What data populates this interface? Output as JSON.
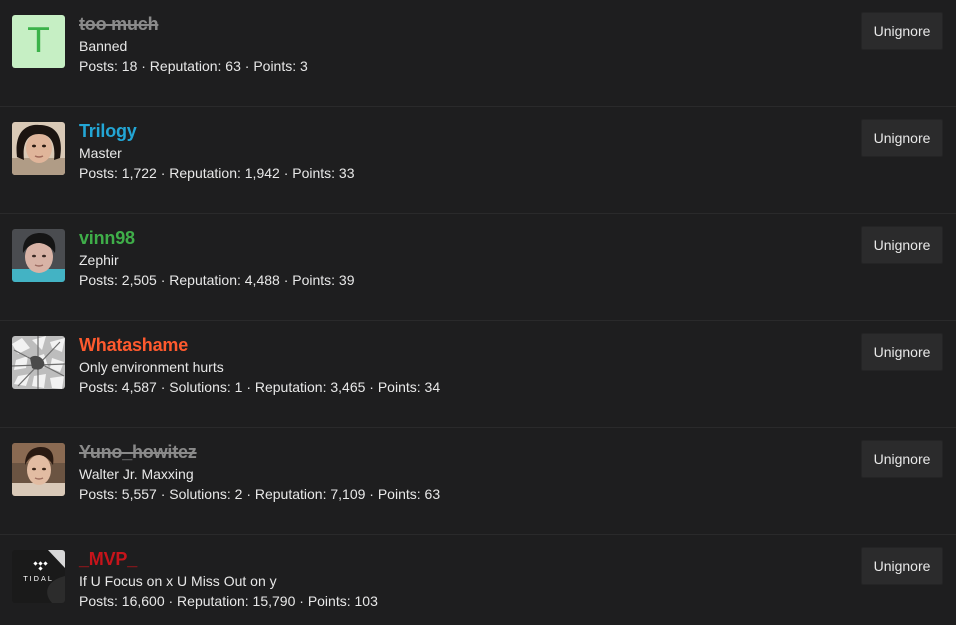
{
  "colors": {
    "background": "#1e1e1f",
    "button_bg": "#2b2b2c",
    "banned_name": "#8a8a8a",
    "master_name": "#23a6d5",
    "zephir_name": "#3fae49",
    "orange_name": "#ff5a2e",
    "red_name": "#c7141b"
  },
  "ignored_users": [
    {
      "avatar_letter": "T",
      "username": "too much",
      "title": "Banned",
      "stats": "Posts: 18 · Reputation: 63 · Points: 3",
      "button": "Unignore"
    },
    {
      "avatar_icon": "user-photo-avatar",
      "username": "Trilogy",
      "title": "Master",
      "stats": "Posts: 1,722 · Reputation: 1,942 · Points: 33",
      "button": "Unignore"
    },
    {
      "avatar_icon": "user-photo-avatar",
      "username": "vinn98",
      "title": "Zephir",
      "stats": "Posts: 2,505 · Reputation: 4,488 · Points: 39",
      "button": "Unignore"
    },
    {
      "avatar_icon": "user-photo-avatar",
      "username": "Whatashame",
      "title": "Only environment hurts",
      "stats": "Posts: 4,587 · Solutions: 1 · Reputation: 3,465 · Points: 34",
      "button": "Unignore"
    },
    {
      "avatar_icon": "user-photo-avatar",
      "username": "Yuno_howitez",
      "title": "Walter Jr. Maxxing",
      "stats": "Posts: 5,557 · Solutions: 2 · Reputation: 7,109 · Points: 63",
      "button": "Unignore"
    },
    {
      "avatar_logo_text": "TIDAL",
      "username": "_MVP_",
      "title": "If U Focus on x U Miss Out on y",
      "stats": "Posts: 16,600 · Reputation: 15,790 · Points: 103",
      "button": "Unignore"
    }
  ]
}
